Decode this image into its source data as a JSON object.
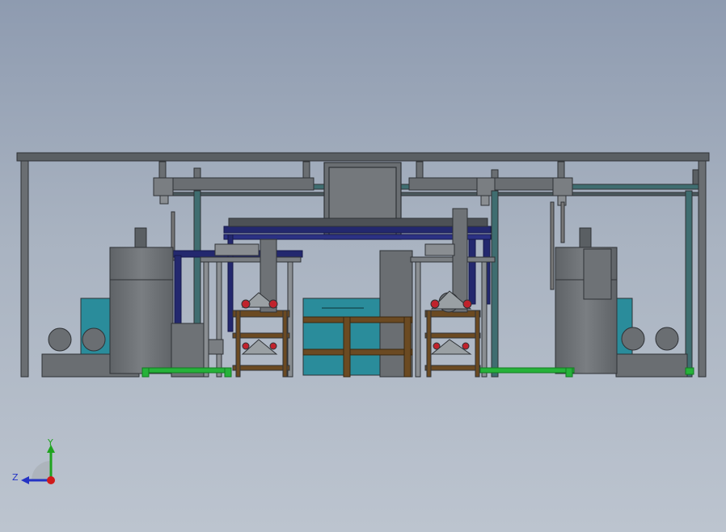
{
  "viewport": {
    "background_top": "#8e9bb0",
    "background_bottom": "#bcc4cf"
  },
  "colors": {
    "frame_gray": "#5a5f63",
    "frame_dark": "#2f3236",
    "cabinet_gray": "#6e7276",
    "teal": "#2a8c9b",
    "navy": "#23286e",
    "brown": "#6b4a22",
    "green": "#26b23a",
    "red": "#c0222c",
    "steel_teal": "#3f6d70"
  },
  "triad": {
    "y_label": "Y",
    "z_label": "Z",
    "y_color": "#1fa31f",
    "z_color": "#2433c4",
    "x_color": "#d01a1a"
  }
}
